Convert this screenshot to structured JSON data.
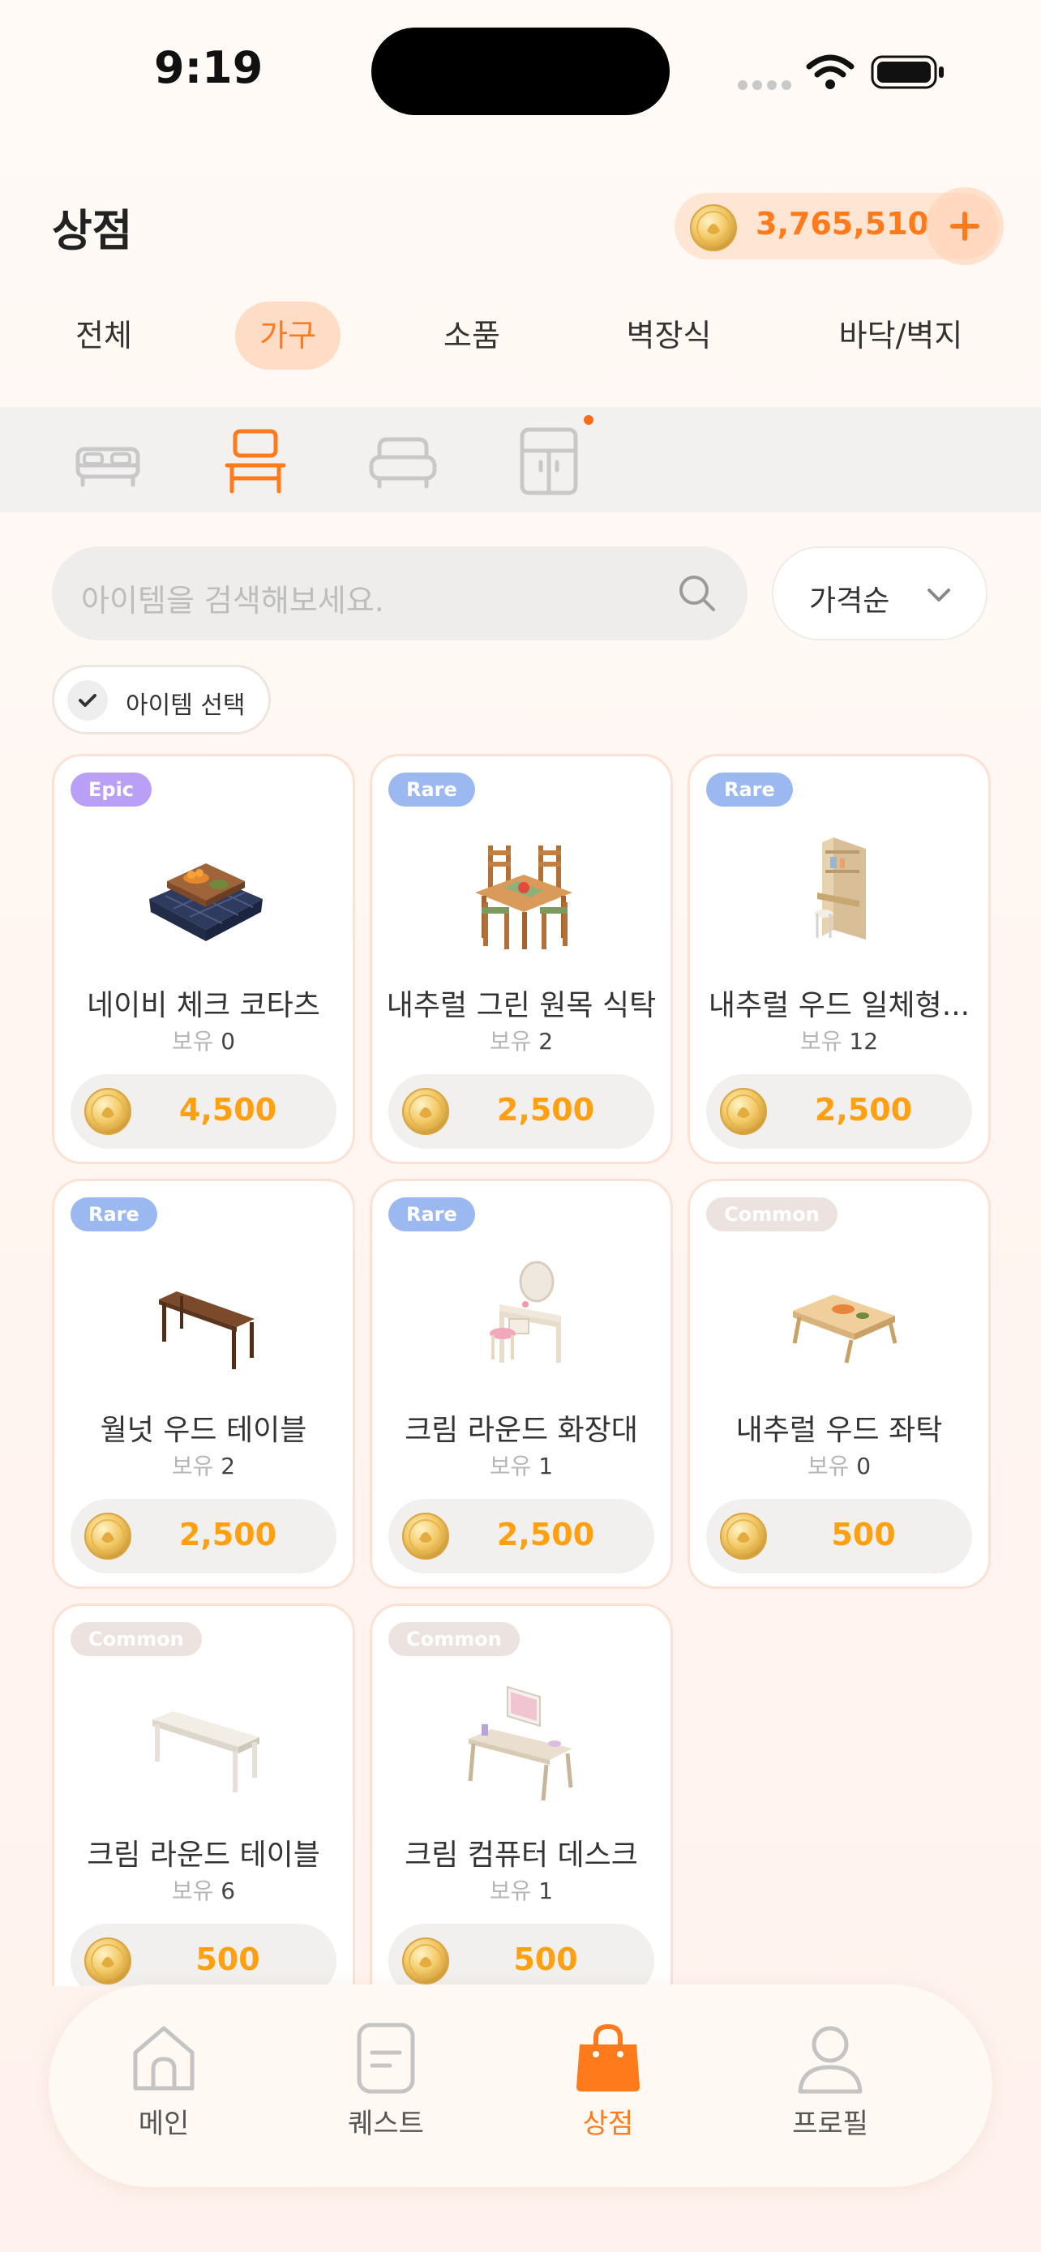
{
  "status": {
    "time": "9:19"
  },
  "header": {
    "title": "상점",
    "coins": "3,765,510"
  },
  "categories": [
    {
      "label": "전체",
      "active": false
    },
    {
      "label": "가구",
      "active": true
    },
    {
      "label": "소품",
      "active": false
    },
    {
      "label": "벽장식",
      "active": false
    },
    {
      "label": "바닥/벽지",
      "active": false
    }
  ],
  "subcategories": [
    {
      "icon": "bed-icon",
      "active": false
    },
    {
      "icon": "desk-icon",
      "active": true
    },
    {
      "icon": "sofa-icon",
      "active": false
    },
    {
      "icon": "cabinet-icon",
      "active": false,
      "has_notification": true
    }
  ],
  "search": {
    "placeholder": "아이템을 검색해보세요."
  },
  "sort": {
    "label": "가격순"
  },
  "select_chip": {
    "label": "아이템 선택"
  },
  "owned_label": "보유",
  "items": [
    {
      "rarity": "Epic",
      "name": "네이비 체크 코타츠",
      "owned": "0",
      "price": "4,500",
      "icon": "kotatsu-icon"
    },
    {
      "rarity": "Rare",
      "name": "내추럴 그린 원목 식탁",
      "owned": "2",
      "price": "2,500",
      "icon": "dining-table-icon"
    },
    {
      "rarity": "Rare",
      "name": "내추럴 우드 일체형...",
      "owned": "12",
      "price": "2,500",
      "icon": "desk-shelf-icon"
    },
    {
      "rarity": "Rare",
      "name": "월넛 우드 테이블",
      "owned": "2",
      "price": "2,500",
      "icon": "walnut-table-icon"
    },
    {
      "rarity": "Rare",
      "name": "크림 라운드 화장대",
      "owned": "1",
      "price": "2,500",
      "icon": "vanity-icon"
    },
    {
      "rarity": "Common",
      "name": "내추럴 우드 좌탁",
      "owned": "0",
      "price": "500",
      "icon": "low-table-icon"
    },
    {
      "rarity": "Common",
      "name": "크림 라운드 테이블",
      "owned": "6",
      "price": "500",
      "icon": "cream-table-icon"
    },
    {
      "rarity": "Common",
      "name": "크림 컴퓨터 데스크",
      "owned": "1",
      "price": "500",
      "icon": "computer-desk-icon"
    }
  ],
  "nav": [
    {
      "label": "메인",
      "icon": "home-icon",
      "active": false
    },
    {
      "label": "퀘스트",
      "icon": "quest-icon",
      "active": false
    },
    {
      "label": "상점",
      "icon": "shop-bag-icon",
      "active": true
    },
    {
      "label": "프로필",
      "icon": "profile-icon",
      "active": false
    }
  ],
  "colors": {
    "accent": "#ff7a1a",
    "coin_text": "#ffa012",
    "epic": "#b9a0f6",
    "rare": "#9cb8f0",
    "common": "#ece3e0"
  }
}
